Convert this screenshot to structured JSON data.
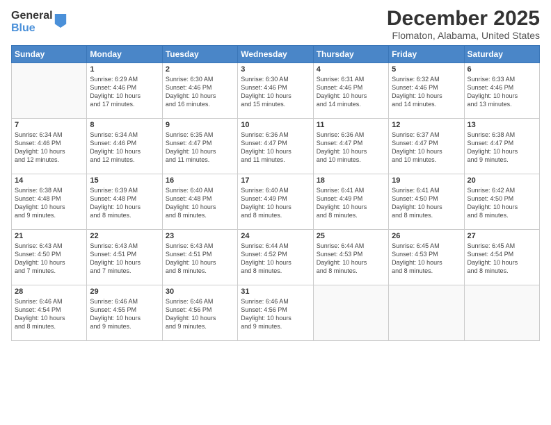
{
  "logo": {
    "general": "General",
    "blue": "Blue"
  },
  "title": "December 2025",
  "subtitle": "Flomaton, Alabama, United States",
  "days_of_week": [
    "Sunday",
    "Monday",
    "Tuesday",
    "Wednesday",
    "Thursday",
    "Friday",
    "Saturday"
  ],
  "weeks": [
    [
      {
        "day": "",
        "info": ""
      },
      {
        "day": "1",
        "info": "Sunrise: 6:29 AM\nSunset: 4:46 PM\nDaylight: 10 hours\nand 17 minutes."
      },
      {
        "day": "2",
        "info": "Sunrise: 6:30 AM\nSunset: 4:46 PM\nDaylight: 10 hours\nand 16 minutes."
      },
      {
        "day": "3",
        "info": "Sunrise: 6:30 AM\nSunset: 4:46 PM\nDaylight: 10 hours\nand 15 minutes."
      },
      {
        "day": "4",
        "info": "Sunrise: 6:31 AM\nSunset: 4:46 PM\nDaylight: 10 hours\nand 14 minutes."
      },
      {
        "day": "5",
        "info": "Sunrise: 6:32 AM\nSunset: 4:46 PM\nDaylight: 10 hours\nand 14 minutes."
      },
      {
        "day": "6",
        "info": "Sunrise: 6:33 AM\nSunset: 4:46 PM\nDaylight: 10 hours\nand 13 minutes."
      }
    ],
    [
      {
        "day": "7",
        "info": "Sunrise: 6:34 AM\nSunset: 4:46 PM\nDaylight: 10 hours\nand 12 minutes."
      },
      {
        "day": "8",
        "info": "Sunrise: 6:34 AM\nSunset: 4:46 PM\nDaylight: 10 hours\nand 12 minutes."
      },
      {
        "day": "9",
        "info": "Sunrise: 6:35 AM\nSunset: 4:47 PM\nDaylight: 10 hours\nand 11 minutes."
      },
      {
        "day": "10",
        "info": "Sunrise: 6:36 AM\nSunset: 4:47 PM\nDaylight: 10 hours\nand 11 minutes."
      },
      {
        "day": "11",
        "info": "Sunrise: 6:36 AM\nSunset: 4:47 PM\nDaylight: 10 hours\nand 10 minutes."
      },
      {
        "day": "12",
        "info": "Sunrise: 6:37 AM\nSunset: 4:47 PM\nDaylight: 10 hours\nand 10 minutes."
      },
      {
        "day": "13",
        "info": "Sunrise: 6:38 AM\nSunset: 4:47 PM\nDaylight: 10 hours\nand 9 minutes."
      }
    ],
    [
      {
        "day": "14",
        "info": "Sunrise: 6:38 AM\nSunset: 4:48 PM\nDaylight: 10 hours\nand 9 minutes."
      },
      {
        "day": "15",
        "info": "Sunrise: 6:39 AM\nSunset: 4:48 PM\nDaylight: 10 hours\nand 8 minutes."
      },
      {
        "day": "16",
        "info": "Sunrise: 6:40 AM\nSunset: 4:48 PM\nDaylight: 10 hours\nand 8 minutes."
      },
      {
        "day": "17",
        "info": "Sunrise: 6:40 AM\nSunset: 4:49 PM\nDaylight: 10 hours\nand 8 minutes."
      },
      {
        "day": "18",
        "info": "Sunrise: 6:41 AM\nSunset: 4:49 PM\nDaylight: 10 hours\nand 8 minutes."
      },
      {
        "day": "19",
        "info": "Sunrise: 6:41 AM\nSunset: 4:50 PM\nDaylight: 10 hours\nand 8 minutes."
      },
      {
        "day": "20",
        "info": "Sunrise: 6:42 AM\nSunset: 4:50 PM\nDaylight: 10 hours\nand 8 minutes."
      }
    ],
    [
      {
        "day": "21",
        "info": "Sunrise: 6:43 AM\nSunset: 4:50 PM\nDaylight: 10 hours\nand 7 minutes."
      },
      {
        "day": "22",
        "info": "Sunrise: 6:43 AM\nSunset: 4:51 PM\nDaylight: 10 hours\nand 7 minutes."
      },
      {
        "day": "23",
        "info": "Sunrise: 6:43 AM\nSunset: 4:51 PM\nDaylight: 10 hours\nand 8 minutes."
      },
      {
        "day": "24",
        "info": "Sunrise: 6:44 AM\nSunset: 4:52 PM\nDaylight: 10 hours\nand 8 minutes."
      },
      {
        "day": "25",
        "info": "Sunrise: 6:44 AM\nSunset: 4:53 PM\nDaylight: 10 hours\nand 8 minutes."
      },
      {
        "day": "26",
        "info": "Sunrise: 6:45 AM\nSunset: 4:53 PM\nDaylight: 10 hours\nand 8 minutes."
      },
      {
        "day": "27",
        "info": "Sunrise: 6:45 AM\nSunset: 4:54 PM\nDaylight: 10 hours\nand 8 minutes."
      }
    ],
    [
      {
        "day": "28",
        "info": "Sunrise: 6:46 AM\nSunset: 4:54 PM\nDaylight: 10 hours\nand 8 minutes."
      },
      {
        "day": "29",
        "info": "Sunrise: 6:46 AM\nSunset: 4:55 PM\nDaylight: 10 hours\nand 9 minutes."
      },
      {
        "day": "30",
        "info": "Sunrise: 6:46 AM\nSunset: 4:56 PM\nDaylight: 10 hours\nand 9 minutes."
      },
      {
        "day": "31",
        "info": "Sunrise: 6:46 AM\nSunset: 4:56 PM\nDaylight: 10 hours\nand 9 minutes."
      },
      {
        "day": "",
        "info": ""
      },
      {
        "day": "",
        "info": ""
      },
      {
        "day": "",
        "info": ""
      }
    ]
  ]
}
